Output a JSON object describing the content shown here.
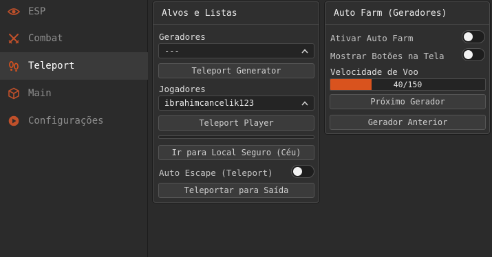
{
  "sidebar": {
    "items": [
      {
        "label": "ESP",
        "icon": "eye-icon",
        "active": false
      },
      {
        "label": "Combat",
        "icon": "crossed-swords-icon",
        "active": false
      },
      {
        "label": "Teleport",
        "icon": "footprints-icon",
        "active": true
      },
      {
        "label": "Main",
        "icon": "cube-icon",
        "active": false
      },
      {
        "label": "Configurações",
        "icon": "play-circle-icon",
        "active": false
      }
    ]
  },
  "targets_panel": {
    "title": "Alvos e Listas",
    "generators_label": "Geradores",
    "generators_value": "---",
    "teleport_generator_button": "Teleport Generator",
    "players_label": "Jogadores",
    "players_value": "ibrahimcancelik123",
    "teleport_player_button": "Teleport Player",
    "safe_place_button": "Ir para Local Seguro (Céu)",
    "auto_escape_label": "Auto Escape (Teleport)",
    "auto_escape_on": false,
    "teleport_exit_button": "Teleportar para Saída"
  },
  "autofarm_panel": {
    "title": "Auto Farm (Geradores)",
    "enable_label": "Ativar Auto Farm",
    "enable_on": false,
    "show_buttons_label": "Mostrar Botões na Tela",
    "show_buttons_on": false,
    "speed_label": "Velocidade de Voo",
    "speed_value": 40,
    "speed_max": 150,
    "speed_text": "40/150",
    "next_generator_button": "Próximo Gerador",
    "prev_generator_button": "Gerador Anterior"
  },
  "colors": {
    "accent": "#d9531e",
    "background": "#2b2b2b",
    "panel": "#2f2f2f"
  }
}
